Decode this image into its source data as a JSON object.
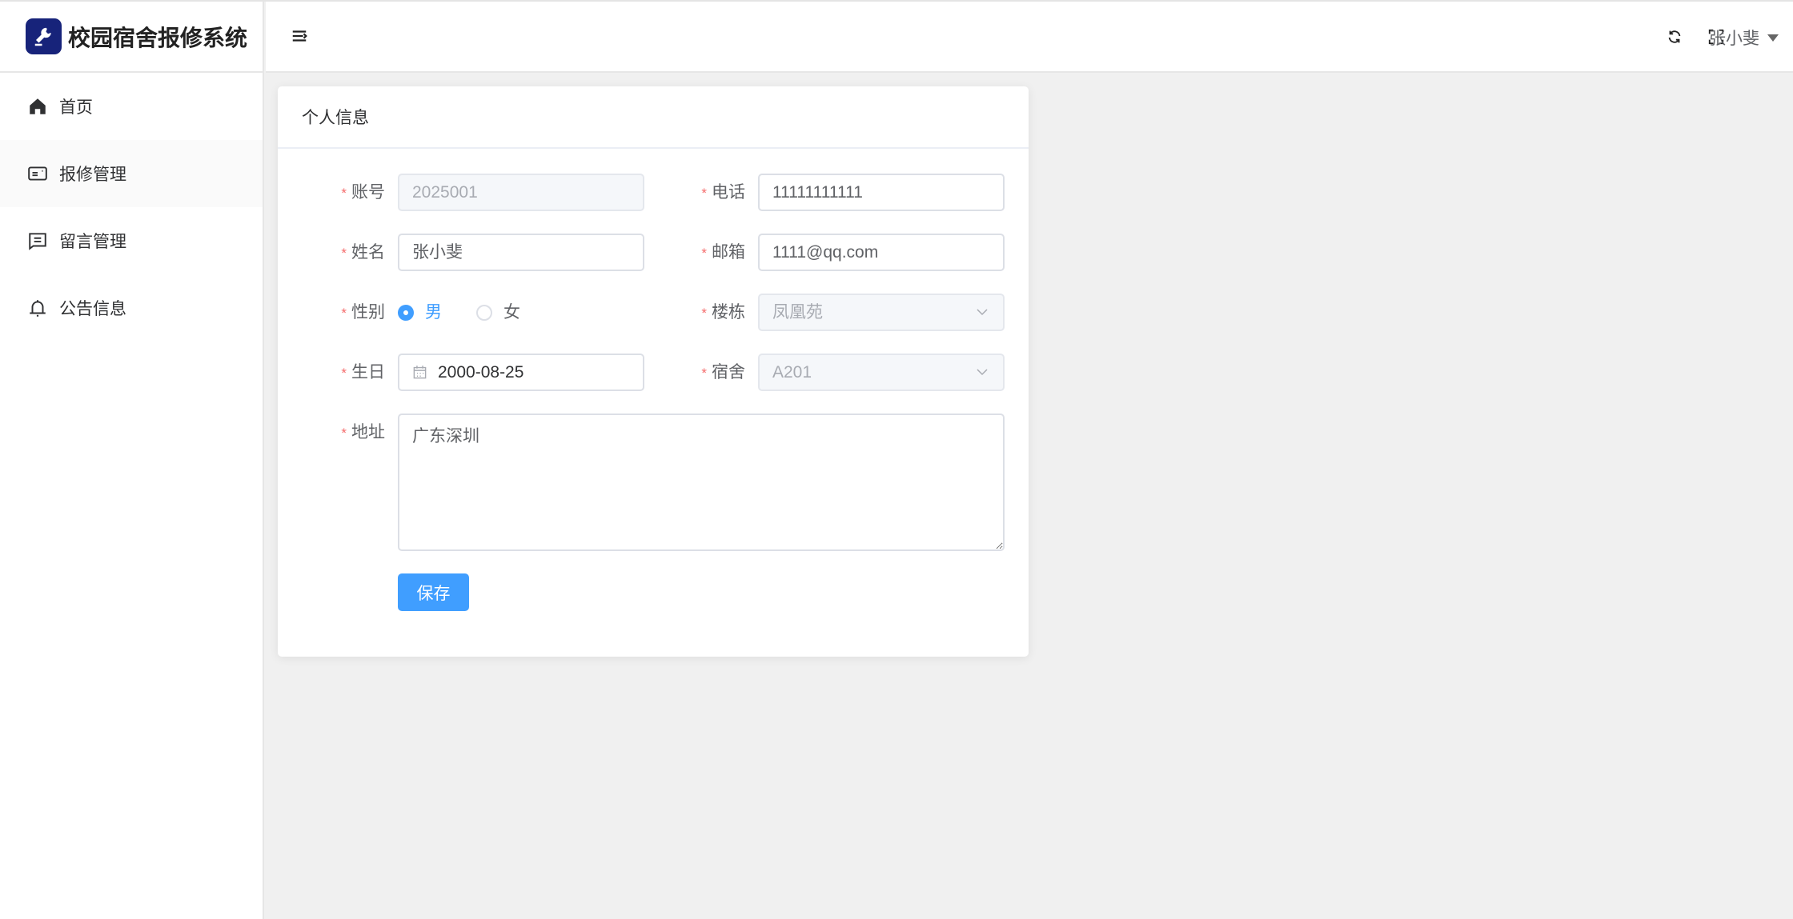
{
  "app": {
    "title": "校园宿舍报修系统"
  },
  "sidebar": {
    "items": [
      {
        "label": "首页",
        "icon": "home-icon"
      },
      {
        "label": "报修管理",
        "icon": "repair-card-icon"
      },
      {
        "label": "留言管理",
        "icon": "message-icon"
      },
      {
        "label": "公告信息",
        "icon": "bell-icon"
      }
    ]
  },
  "header": {
    "user": "张小斐"
  },
  "card": {
    "title": "个人信息"
  },
  "form": {
    "account": {
      "label": "账号",
      "value": "2025001"
    },
    "phone": {
      "label": "电话",
      "value": "11111111111"
    },
    "name": {
      "label": "姓名",
      "value": "张小斐"
    },
    "email": {
      "label": "邮箱",
      "value": "1111@qq.com"
    },
    "gender": {
      "label": "性别",
      "options": [
        "男",
        "女"
      ],
      "selected": "男"
    },
    "building": {
      "label": "楼栋",
      "value": "凤凰苑"
    },
    "birthday": {
      "label": "生日",
      "value": "2000-08-25"
    },
    "dorm": {
      "label": "宿舍",
      "value": "A201"
    },
    "address": {
      "label": "地址",
      "value": "广东深圳"
    },
    "required_mark": "*",
    "save_label": "保存"
  },
  "colors": {
    "primary": "#409eff",
    "logo": "#17237a",
    "required": "#f56c6c"
  }
}
